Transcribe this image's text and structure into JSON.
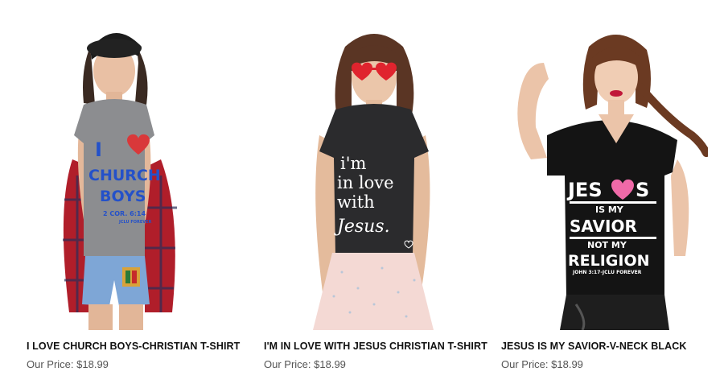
{
  "products": [
    {
      "name": "I LOVE CHURCH BOYS-CHRISTIAN T-SHIRT",
      "price_label": "Our Price:",
      "price": "$18.99",
      "shirt_text": {
        "line1": "I",
        "line2": "CHURCH",
        "line3": "BOYS",
        "line4": "2 COR. 6:14",
        "line5": "JCLU FOREVER"
      },
      "colors": {
        "shirt": "#8c8d90",
        "print": "#2451c9",
        "heart": "#d9383a"
      }
    },
    {
      "name": "I'M IN LOVE WITH JESUS CHRISTIAN T-SHIRT",
      "price_label": "Our Price:",
      "price": "$18.99",
      "shirt_text": {
        "line1": "i'm",
        "line2": "in love",
        "line3": "with",
        "line4": "Jesus."
      },
      "colors": {
        "shirt": "#2b2b2d",
        "print": "#ffffff",
        "glasses": "#e0242e"
      }
    },
    {
      "name": "JESUS IS MY SAVIOR-V-NECK BLACK",
      "price_label": "Our Price:",
      "price": "$18.99",
      "shirt_text": {
        "line1a": "JES",
        "line1b": "S",
        "line2": "IS MY",
        "line3": "SAVIOR",
        "line4": "NOT MY",
        "line5": "RELIGION",
        "line6": "JOHN 3:17-JCLU FOREVER"
      },
      "colors": {
        "shirt": "#141414",
        "print": "#ffffff",
        "heart": "#f06aa8"
      }
    }
  ]
}
